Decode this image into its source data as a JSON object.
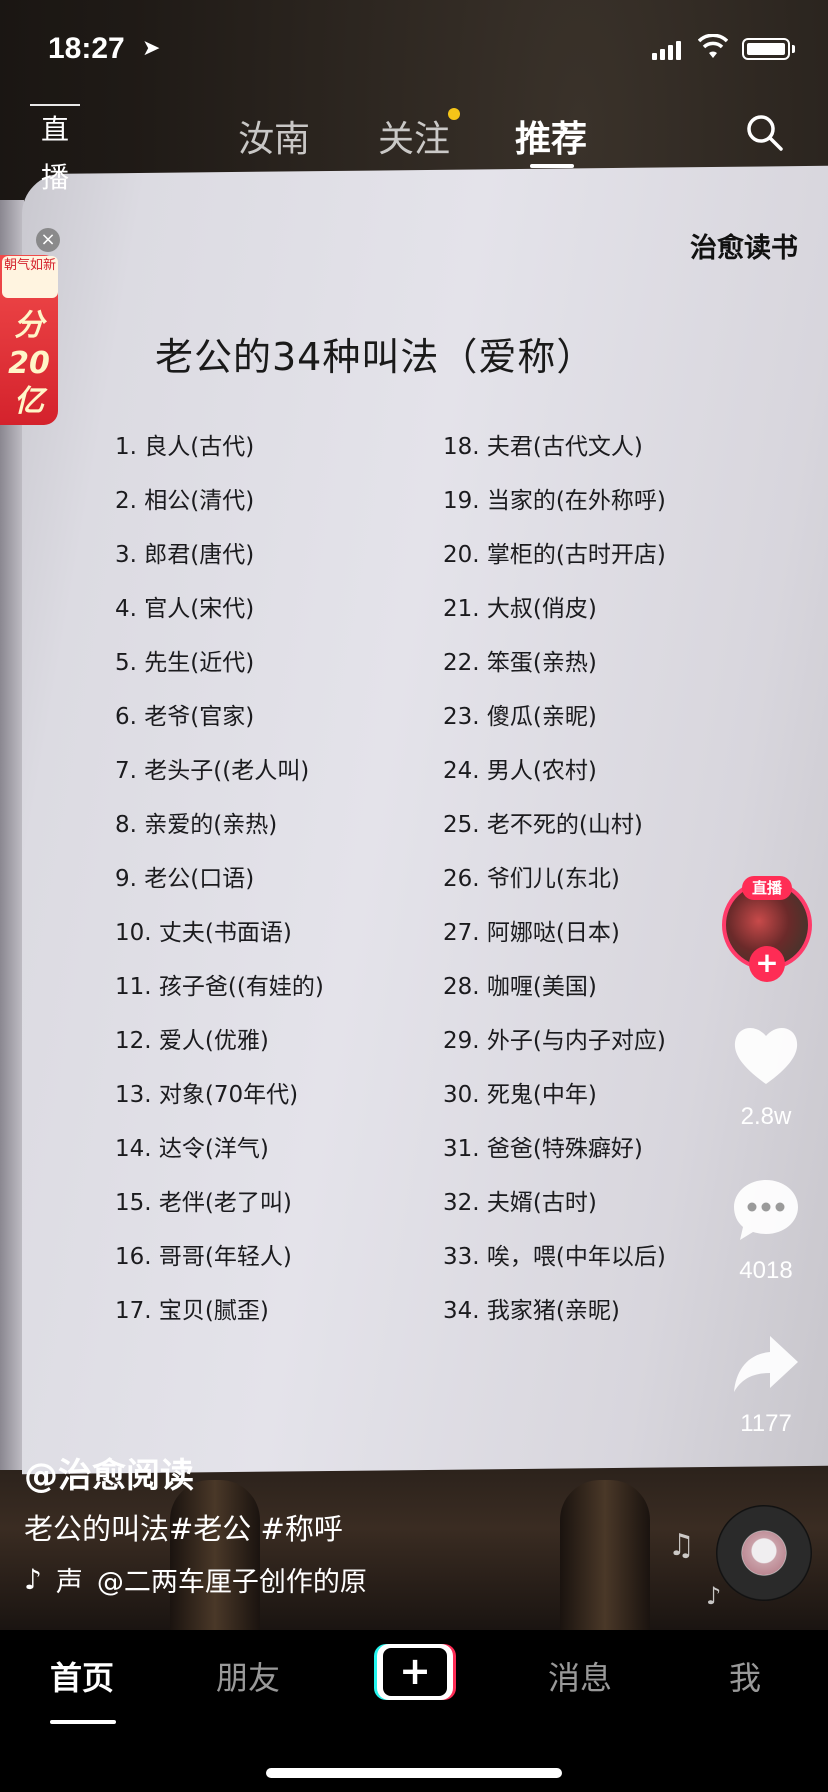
{
  "status_bar": {
    "time": "18:27"
  },
  "top_tabs": {
    "live_label": "直播",
    "tabs": [
      "汝南",
      "关注",
      "推荐"
    ],
    "active_index": 2
  },
  "promo": {
    "badge": "朝气如新",
    "text_lines": [
      "分",
      "20",
      "亿"
    ]
  },
  "book": {
    "brand": "治愈读书",
    "title": "老公的34种叫法（爱称）",
    "left_items": [
      "1. 良人(古代)",
      "2. 相公(清代)",
      "3. 郎君(唐代)",
      "4. 官人(宋代)",
      "5. 先生(近代)",
      "6. 老爷(官家)",
      "7. 老头子((老人叫)",
      "8. 亲爱的(亲热)",
      "9. 老公(口语)",
      "10. 丈夫(书面语)",
      "11. 孩子爸((有娃的)",
      "12. 爱人(优雅)",
      "13. 对象(70年代)",
      "14. 达令(洋气)",
      "15. 老伴(老了叫)",
      "16. 哥哥(年轻人)",
      "17. 宝贝(腻歪)"
    ],
    "right_items": [
      "18. 夫君(古代文人)",
      "19. 当家的(在外称呼)",
      "20. 掌柜的(古时开店)",
      "21. 大叔(俏皮)",
      "22. 笨蛋(亲热)",
      "23. 傻瓜(亲昵)",
      "24. 男人(农村)",
      "25. 老不死的(山村)",
      "26. 爷们儿(东北)",
      "27. 阿娜哒(日本)",
      "28. 咖喱(美国)",
      "29. 外子(与内子对应)",
      "30. 死鬼(中年)",
      "31. 爸爸(特殊癖好)",
      "32. 夫婿(古时)",
      "33. 唉，喂(中年以后)",
      "34. 我家猪(亲昵)"
    ]
  },
  "side": {
    "live_tag": "直播",
    "likes": "2.8w",
    "comments": "4018",
    "shares": "1177"
  },
  "caption": {
    "author": "@治愈阅读",
    "text": "老公的叫法#老公 #称呼",
    "music_prefix": "声",
    "music": "@二两车厘子创作的原"
  },
  "bottom_nav": {
    "items": [
      "首页",
      "朋友",
      "消息",
      "我"
    ]
  },
  "colors": {
    "accent": "#fe2c55",
    "notify_dot": "#f5c518",
    "cyan": "#25f4ee"
  }
}
